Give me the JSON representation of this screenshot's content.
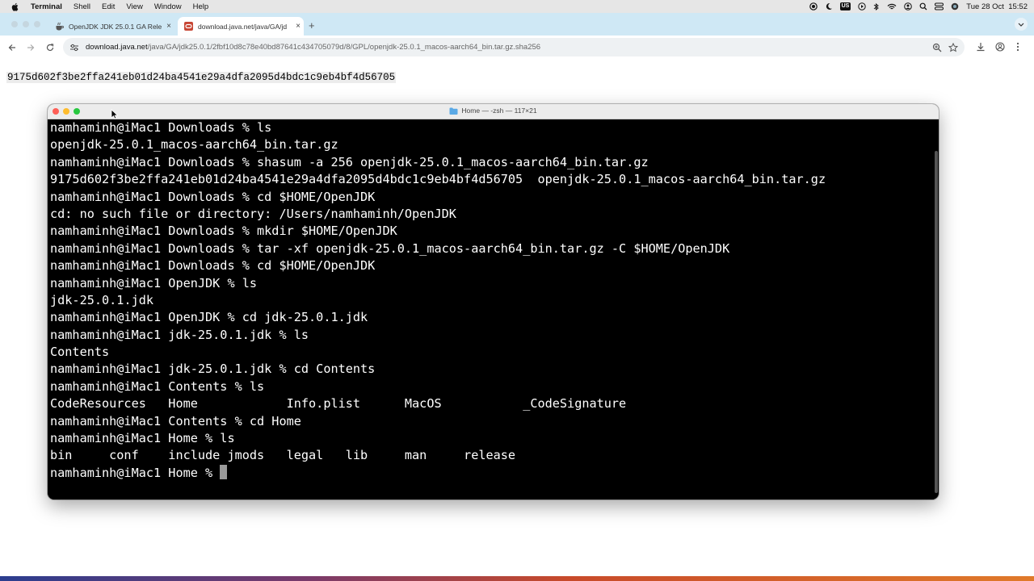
{
  "menubar": {
    "app": "Terminal",
    "items": [
      "Shell",
      "Edit",
      "View",
      "Window",
      "Help"
    ],
    "input_source": "US",
    "clock": "Tue 28 Oct  15:52"
  },
  "browser": {
    "tabs": [
      {
        "title": "OpenJDK JDK 25.0.1 GA Rele",
        "active": false
      },
      {
        "title": "download.java.net/java/GA/jd",
        "active": true
      }
    ],
    "new_tab_label": "+",
    "tab_close_label": "×",
    "url_host": "download.java.net",
    "url_path": "/java/GA/jdk25.0.1/2fbf10d8c78e40bd87641c434705079d/8/GPL/openjdk-25.0.1_macos-aarch64_bin.tar.gz.sha256"
  },
  "page": {
    "hash_text": "9175d602f3be2ffa241eb01d24ba4541e29a4dfa2095d4bdc1c9eb4bf4d56705"
  },
  "terminal": {
    "title": "Home — -zsh — 117×21",
    "lines": [
      "namhaminh@iMac1 Downloads % ls",
      "openjdk-25.0.1_macos-aarch64_bin.tar.gz",
      "namhaminh@iMac1 Downloads % shasum -a 256 openjdk-25.0.1_macos-aarch64_bin.tar.gz",
      "9175d602f3be2ffa241eb01d24ba4541e29a4dfa2095d4bdc1c9eb4bf4d56705  openjdk-25.0.1_macos-aarch64_bin.tar.gz",
      "namhaminh@iMac1 Downloads % cd $HOME/OpenJDK",
      "cd: no such file or directory: /Users/namhaminh/OpenJDK",
      "namhaminh@iMac1 Downloads % mkdir $HOME/OpenJDK",
      "namhaminh@iMac1 Downloads % tar -xf openjdk-25.0.1_macos-aarch64_bin.tar.gz -C $HOME/OpenJDK",
      "namhaminh@iMac1 Downloads % cd $HOME/OpenJDK",
      "namhaminh@iMac1 OpenJDK % ls",
      "jdk-25.0.1.jdk",
      "namhaminh@iMac1 OpenJDK % cd jdk-25.0.1.jdk",
      "namhaminh@iMac1 jdk-25.0.1.jdk % ls",
      "Contents",
      "namhaminh@iMac1 jdk-25.0.1.jdk % cd Contents",
      "namhaminh@iMac1 Contents % ls",
      "CodeResources   Home            Info.plist      MacOS           _CodeSignature",
      "namhaminh@iMac1 Contents % cd Home",
      "namhaminh@iMac1 Home % ls",
      "bin     conf    include jmods   legal   lib     man     release"
    ],
    "prompt": "namhaminh@iMac1 Home % "
  },
  "colors": {
    "tabstrip": "#cfe8f5",
    "terminal_bg": "#000000",
    "terminal_fg": "#ffffff",
    "close_red": "#fe5f57",
    "minimize_yellow": "#febc2e",
    "zoom_green": "#28c840"
  },
  "icons": {
    "menubar": [
      "apple-icon",
      "record-icon",
      "moon-icon",
      "play-icon",
      "bluetooth-icon",
      "wifi-icon",
      "user-icon",
      "search-icon",
      "control-center-icon",
      "siri-icon"
    ],
    "toolbar": [
      "back-icon",
      "forward-icon",
      "reload-icon",
      "site-settings-icon",
      "zoom-icon",
      "bookmark-star-icon",
      "download-icon",
      "profile-icon",
      "more-icon"
    ],
    "terminal": [
      "folder-icon"
    ]
  }
}
